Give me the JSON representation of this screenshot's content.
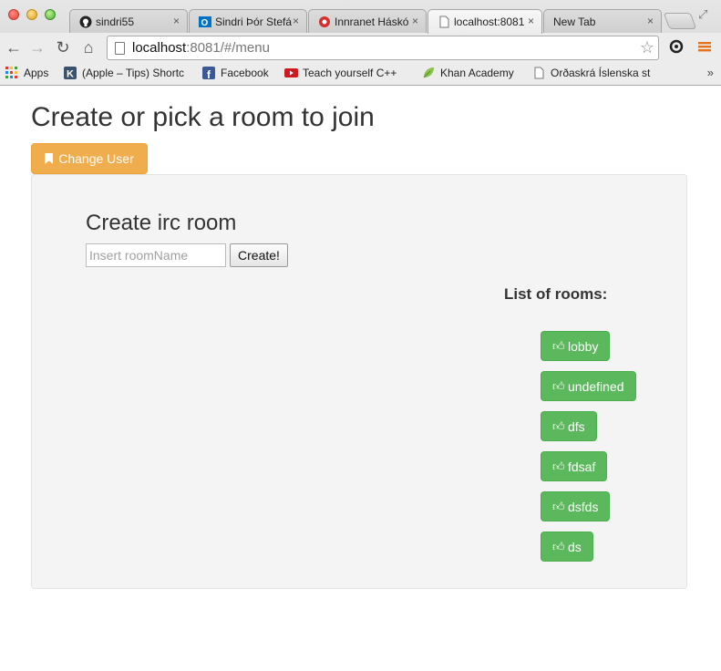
{
  "browser": {
    "tabs": [
      {
        "title": "sindri55",
        "icon": "github-icon",
        "active": false
      },
      {
        "title": "Sindri Þór Stefá",
        "icon": "outlook-icon",
        "active": false
      },
      {
        "title": "Innranet Háskó",
        "icon": "university-icon",
        "active": false
      },
      {
        "title": "localhost:8081",
        "icon": "page-icon",
        "active": true
      },
      {
        "title": "New Tab",
        "icon": "",
        "active": false
      }
    ],
    "close_glyph": "×",
    "url": {
      "host": "localhost",
      "rest": ":8081/#/menu"
    },
    "bookmarks": [
      {
        "label": "Apps",
        "icon": "apps-grid-icon"
      },
      {
        "label": "(Apple – Tips) Shortc",
        "icon": "k-logo-icon"
      },
      {
        "label": "Facebook",
        "icon": "facebook-icon"
      },
      {
        "label": "Teach yourself C++",
        "icon": "youtube-icon"
      },
      {
        "label": "Khan Academy",
        "icon": "khan-leaf-icon"
      },
      {
        "label": "Orðaskrá Íslenska st",
        "icon": "document-icon"
      }
    ],
    "more_bookmarks": "»"
  },
  "page": {
    "title": "Create or pick a room to join",
    "change_user_label": "Change User",
    "create_room_title": "Create irc room",
    "room_input": {
      "value": "",
      "placeholder": "Insert roomName"
    },
    "create_button_label": "Create!",
    "rooms_title": "List of rooms:",
    "rooms": [
      "lobby",
      "undefined",
      "dfs",
      "fdsaf",
      "dsfds",
      "ds"
    ]
  },
  "colors": {
    "warning": "#f0ad4e",
    "success": "#5cb85c",
    "well_bg": "#f4f4f4",
    "text": "#333333"
  }
}
